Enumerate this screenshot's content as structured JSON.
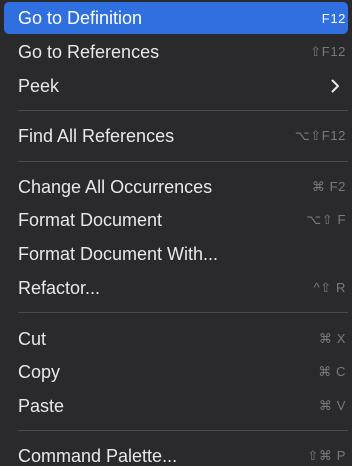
{
  "menu": {
    "items": [
      {
        "label": "Go to Definition",
        "shortcut": "F12"
      },
      {
        "label": "Go to References",
        "shortcut": "⇧F12"
      },
      {
        "label": "Peek",
        "shortcut": ""
      },
      {
        "label": "Find All References",
        "shortcut": "⌥⇧F12"
      },
      {
        "label": "Change All Occurrences",
        "shortcut": "⌘ F2"
      },
      {
        "label": "Format Document",
        "shortcut": "⌥⇧ F"
      },
      {
        "label": "Format Document With...",
        "shortcut": ""
      },
      {
        "label": "Refactor...",
        "shortcut": "^⇧ R"
      },
      {
        "label": "Cut",
        "shortcut": "⌘ X"
      },
      {
        "label": "Copy",
        "shortcut": "⌘ C"
      },
      {
        "label": "Paste",
        "shortcut": "⌘ V"
      },
      {
        "label": "Command Palette...",
        "shortcut": "⇧⌘ P"
      }
    ],
    "selected_item": "Go to Definition",
    "colors": {
      "background": "#2a2a2c",
      "highlight": "#2f6fe0",
      "text": "#e8e8e8",
      "shortcut_text": "#777a80",
      "separator": "#4a4a4d"
    },
    "icons": {
      "peek_submenu": "chevron-right-icon"
    }
  }
}
